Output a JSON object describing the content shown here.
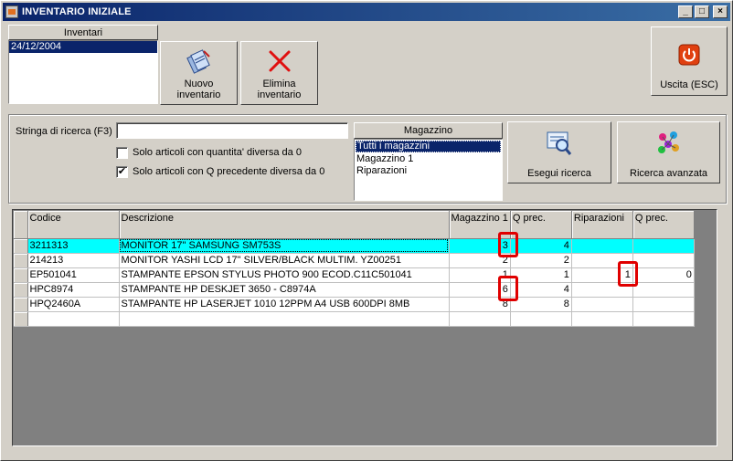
{
  "window": {
    "title": "INVENTARIO INIZIALE"
  },
  "inventari": {
    "header": "Inventari",
    "items": [
      "24/12/2004"
    ]
  },
  "toolbar": {
    "nuovo_label_1": "Nuovo",
    "nuovo_label_2": "inventario",
    "elimina_label_1": "Elimina",
    "elimina_label_2": "inventario",
    "uscita_label": "Uscita (ESC)"
  },
  "search": {
    "label": "Stringa di ricerca (F3)",
    "value": "",
    "check1_label": "Solo articoli con quantita' diversa da 0",
    "check1_checked": false,
    "check2_label": "Solo articoli con Q precedente diversa da 0",
    "check2_checked": true
  },
  "magazzino": {
    "header": "Magazzino",
    "items": [
      "Tutti i magazzini",
      "Magazzino 1",
      "Riparazioni"
    ],
    "selected": "Tutti i magazzini"
  },
  "buttons": {
    "esegui": "Esegui ricerca",
    "avanzata": "Ricerca avanzata"
  },
  "grid": {
    "columns": [
      "Codice",
      "Descrizione",
      "Magazzino 1",
      "Q prec.",
      "Riparazioni",
      "Q prec."
    ],
    "rows": [
      [
        "3211313",
        "MONITOR 17\" SAMSUNG SM753S",
        "3",
        "4",
        "",
        ""
      ],
      [
        "214213",
        "MONITOR YASHI LCD 17\" SILVER/BLACK MULTIM. YZ00251",
        "2",
        "2",
        "",
        ""
      ],
      [
        "EP501041",
        "STAMPANTE EPSON STYLUS PHOTO 900 ECOD.C11C501041",
        "1",
        "1",
        "1",
        "0"
      ],
      [
        "HPC8974",
        "STAMPANTE HP DESKJET 3650 - C8974A",
        "6",
        "4",
        "",
        ""
      ],
      [
        "HPQ2460A",
        "STAMPANTE HP LASERJET 1010 12PPM A4 USB 600DPI 8MB",
        "8",
        "8",
        "",
        ""
      ],
      [
        "",
        "",
        "",
        "",
        "",
        ""
      ]
    ],
    "highlighted_row": 0
  },
  "colors": {
    "title_start": "#0a246a",
    "title_end": "#3a6ea5",
    "row_highlight": "#00ffff",
    "annotation": "#e00000"
  }
}
